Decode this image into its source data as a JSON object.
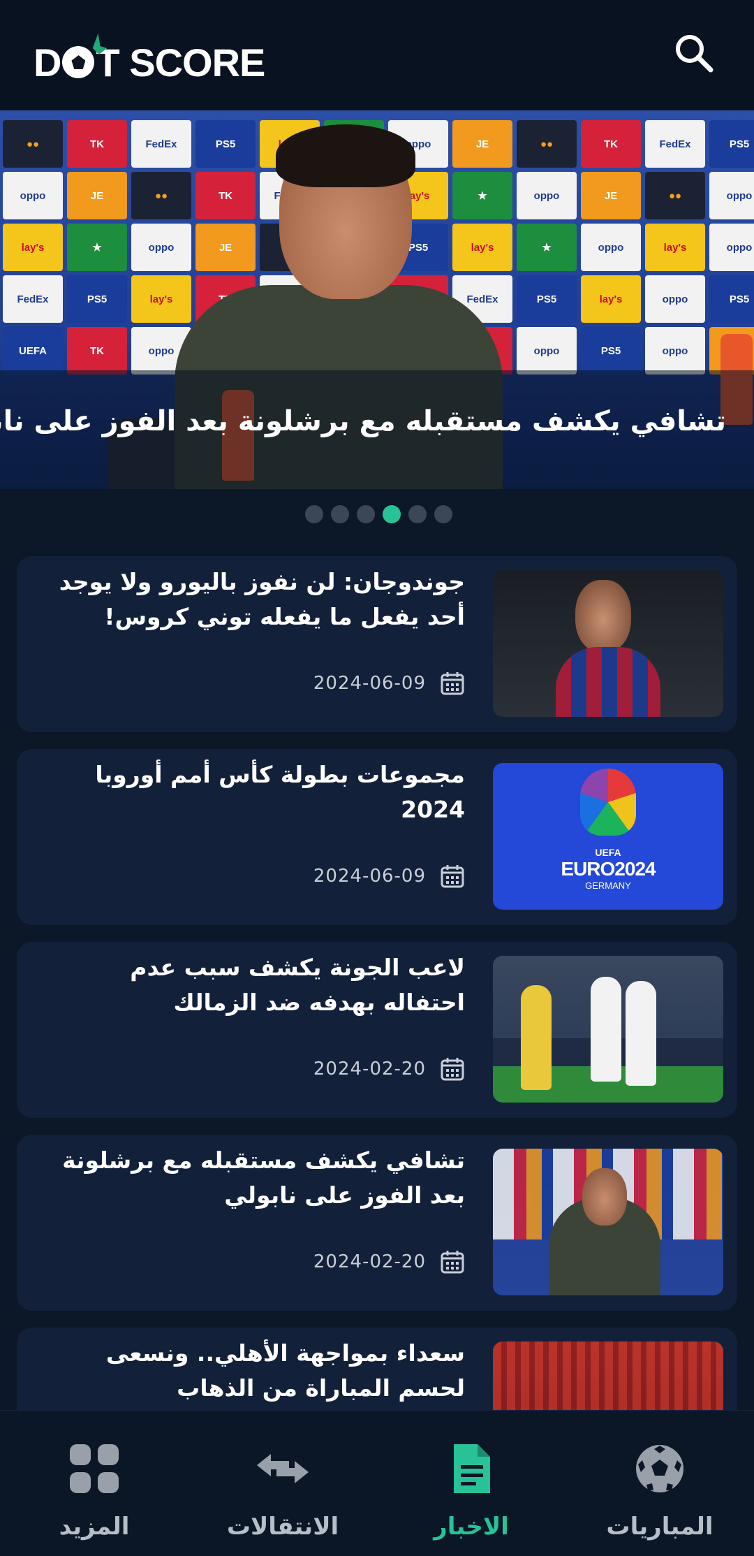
{
  "app": {
    "logo_text_left": "D",
    "logo_text_right": "T SCORE"
  },
  "hero": {
    "title": "تشافي يكشف مستقبله مع برشلونة بعد الفوز على نابولي",
    "dots_count": 6,
    "active_dot": 4
  },
  "news": [
    {
      "title": "جوندوجان: لن نفوز باليورو ولا يوجد أحد يفعل ما يفعله توني كروس!",
      "date": "2024-06-09"
    },
    {
      "title": "مجموعات بطولة كأس أمم أوروبا 2024",
      "date": "2024-06-09"
    },
    {
      "title": "لاعب الجونة يكشف  سبب عدم احتفاله بهدفه ضد الزمالك",
      "date": "2024-02-20"
    },
    {
      "title": "تشافي يكشف مستقبله مع برشلونة بعد الفوز على نابولي",
      "date": "2024-02-20"
    },
    {
      "title": "سعداء بمواجهة الأهلي.. ونسعى لحسم المباراة من الذهاب",
      "date": ""
    }
  ],
  "euro_logo": {
    "line1": "UEFA",
    "line2": "EURO2024",
    "line3": "GERMANY"
  },
  "nav": {
    "more": "المزيد",
    "transfers": "الانتقالات",
    "news": "الاخبار",
    "matches": "المباريات"
  },
  "colors": {
    "accent": "#27c397",
    "background": "#0c1727",
    "card": "#12203a"
  }
}
